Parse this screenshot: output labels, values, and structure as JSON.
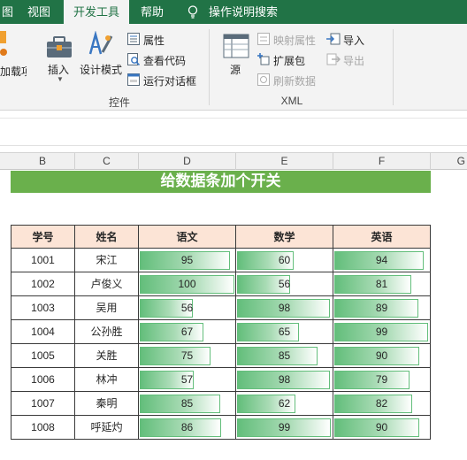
{
  "ribbon_tabs": [
    "图",
    "视图",
    "开发工具",
    "帮助"
  ],
  "active_tab": "开发工具",
  "tell_me": "操作说明搜索",
  "ribbon": {
    "addins_partial": "加载项",
    "insert": "插入",
    "design_mode": "设计模式",
    "properties": "属性",
    "view_code": "查看代码",
    "run_dialog": "运行对话框",
    "controls_group": "控件",
    "source": "源",
    "map_properties": "映射属性",
    "expansion_packs": "扩展包",
    "refresh_data": "刷新数据",
    "import": "导入",
    "export": "导出",
    "xml_group": "XML"
  },
  "column_headers": [
    "B",
    "C",
    "D",
    "E",
    "F",
    "G"
  ],
  "banner_title": "给数据条加个开关",
  "table": {
    "headers": [
      "学号",
      "姓名",
      "语文",
      "数学",
      "英语"
    ],
    "rows": [
      {
        "id": "1001",
        "name": "宋江",
        "chinese": 95,
        "math": 60,
        "english": 94
      },
      {
        "id": "1002",
        "name": "卢俊义",
        "chinese": 100,
        "math": 56,
        "english": 81
      },
      {
        "id": "1003",
        "name": "吴用",
        "chinese": 56,
        "math": 98,
        "english": 89
      },
      {
        "id": "1004",
        "name": "公孙胜",
        "chinese": 67,
        "math": 65,
        "english": 99
      },
      {
        "id": "1005",
        "name": "关胜",
        "chinese": 75,
        "math": 85,
        "english": 90
      },
      {
        "id": "1006",
        "name": "林冲",
        "chinese": 57,
        "math": 98,
        "english": 79
      },
      {
        "id": "1007",
        "name": "秦明",
        "chinese": 85,
        "math": 62,
        "english": 82
      },
      {
        "id": "1008",
        "name": "呼延灼",
        "chinese": 86,
        "math": 99,
        "english": 90
      }
    ]
  },
  "colors": {
    "ribbon_green": "#217346",
    "banner_green": "#6ab04c",
    "header_fill": "#fce4d6",
    "databar_green": "#63be7b"
  }
}
